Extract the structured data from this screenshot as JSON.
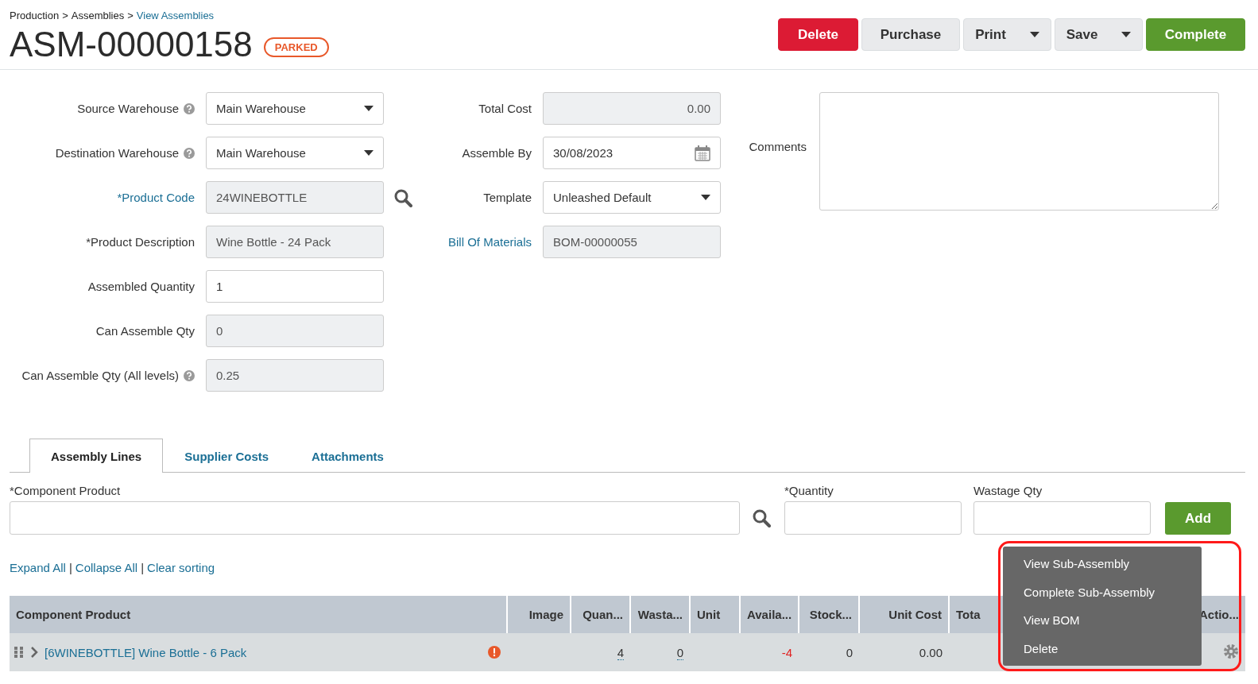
{
  "breadcrumb": {
    "separator": ">",
    "items": [
      {
        "label": "Production",
        "link": false
      },
      {
        "label": "Assemblies",
        "link": false
      },
      {
        "label": "View Assemblies",
        "link": true
      }
    ]
  },
  "title": "ASM-00000158",
  "status": "PARKED",
  "buttons": [
    {
      "label": "Delete",
      "kind": "danger",
      "dropdown": false
    },
    {
      "label": "Purchase",
      "kind": "default",
      "dropdown": false
    },
    {
      "label": "Print",
      "kind": "default",
      "dropdown": true
    },
    {
      "label": "Save",
      "kind": "default",
      "dropdown": true
    },
    {
      "label": "Complete",
      "kind": "success",
      "dropdown": false
    }
  ],
  "fields_left": [
    {
      "label": "Source Warehouse",
      "help": true,
      "link": false,
      "kind": "select",
      "value": "Main Warehouse",
      "readonly": false,
      "lookup": false
    },
    {
      "label": "Destination Warehouse",
      "help": true,
      "link": false,
      "kind": "select",
      "value": "Main Warehouse",
      "readonly": false,
      "lookup": false
    },
    {
      "label": "*Product Code",
      "help": false,
      "link": true,
      "kind": "text",
      "value": "24WINEBOTTLE",
      "readonly": true,
      "lookup": true
    },
    {
      "label": "*Product Description",
      "help": false,
      "link": false,
      "kind": "text",
      "value": "Wine Bottle - 24 Pack",
      "readonly": true,
      "lookup": false
    },
    {
      "label": "Assembled Quantity",
      "help": false,
      "link": false,
      "kind": "text",
      "value": "1",
      "readonly": false,
      "lookup": false
    },
    {
      "label": "Can Assemble Qty",
      "help": false,
      "link": false,
      "kind": "text",
      "value": "0",
      "readonly": true,
      "lookup": false
    },
    {
      "label": "Can Assemble Qty (All levels)",
      "help": true,
      "link": false,
      "kind": "text",
      "value": "0.25",
      "readonly": true,
      "lookup": false
    }
  ],
  "fields_mid": [
    {
      "label": "Total Cost",
      "help": false,
      "link": false,
      "kind": "number",
      "value": "0.00",
      "readonly": true,
      "lookup": false
    },
    {
      "label": "Assemble By",
      "help": false,
      "link": false,
      "kind": "date",
      "value": "30/08/2023",
      "readonly": false,
      "lookup": false
    },
    {
      "label": "Template",
      "help": false,
      "link": false,
      "kind": "select",
      "value": "Unleashed Default",
      "readonly": false,
      "lookup": false
    },
    {
      "label": "Bill Of Materials",
      "help": false,
      "link": true,
      "kind": "text",
      "value": "BOM-00000055",
      "readonly": true,
      "lookup": false
    }
  ],
  "comments": {
    "label": "Comments"
  },
  "tabs": [
    {
      "label": "Assembly Lines",
      "selected": true
    },
    {
      "label": "Supplier Costs",
      "selected": false
    },
    {
      "label": "Attachments",
      "selected": false
    }
  ],
  "entry": {
    "component_label": "*Component Product",
    "quantity_label": "*Quantity",
    "wastage_label": "Wastage Qty",
    "add": "Add"
  },
  "links": {
    "separator": "|",
    "items": [
      "Expand All",
      "Collapse All",
      "Clear sorting"
    ]
  },
  "table": {
    "columns": [
      "Component Product",
      "Image",
      "Quan...",
      "Wasta...",
      "Unit",
      "Availa...",
      "Stock...",
      "Unit Cost",
      "Tota",
      "Actio..."
    ],
    "rows": [
      {
        "product": "[6WINEBOTTLE] Wine Bottle - 6 Pack",
        "warning": true,
        "expanded": false,
        "quantity": "4",
        "wastage": "0",
        "available": "-4",
        "negative": true,
        "stock": "0",
        "unit_cost": "0.00"
      }
    ]
  },
  "menu": {
    "items": [
      "View Sub-Assembly",
      "Complete Sub-Assembly",
      "View BOM",
      "Delete"
    ]
  }
}
